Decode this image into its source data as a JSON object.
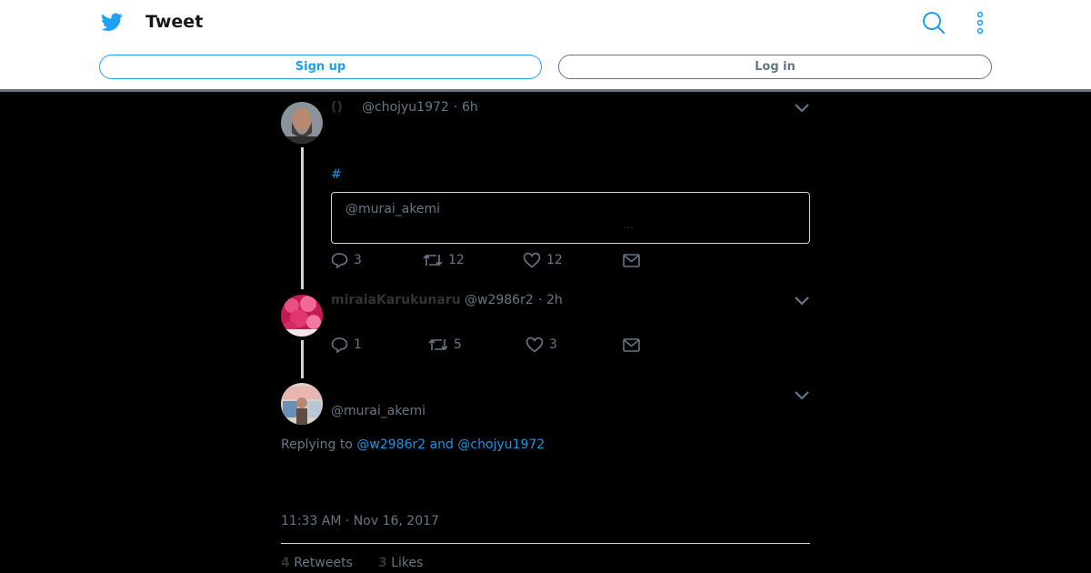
{
  "header": {
    "title": "Tweet",
    "signup_label": "Sign up",
    "login_label": "Log in",
    "accent": "#1da1f2"
  },
  "tweets": [
    {
      "display_name": "()",
      "handle": "@chojyu1972",
      "time": "6h",
      "hashtag": "#",
      "quote": {
        "handle": "@murai_akemi",
        "ellipsis": "…"
      },
      "replies": "3",
      "retweets": "12",
      "likes": "12"
    },
    {
      "display_name": "miraiaKarukunaru",
      "handle": "@w2986r2",
      "time": "2h",
      "replies": "1",
      "retweets": "5",
      "likes": "3"
    }
  ],
  "main_tweet": {
    "handle": "@murai_akemi",
    "replying_prefix": "Replying to",
    "replying_to": "@w2986r2 and @chojyu1972",
    "timestamp": "11:33 AM · Nov 16, 2017",
    "retweet_count": "4",
    "retweet_label": "Retweets",
    "like_count": "3",
    "like_label": "Likes"
  },
  "separator": "·"
}
